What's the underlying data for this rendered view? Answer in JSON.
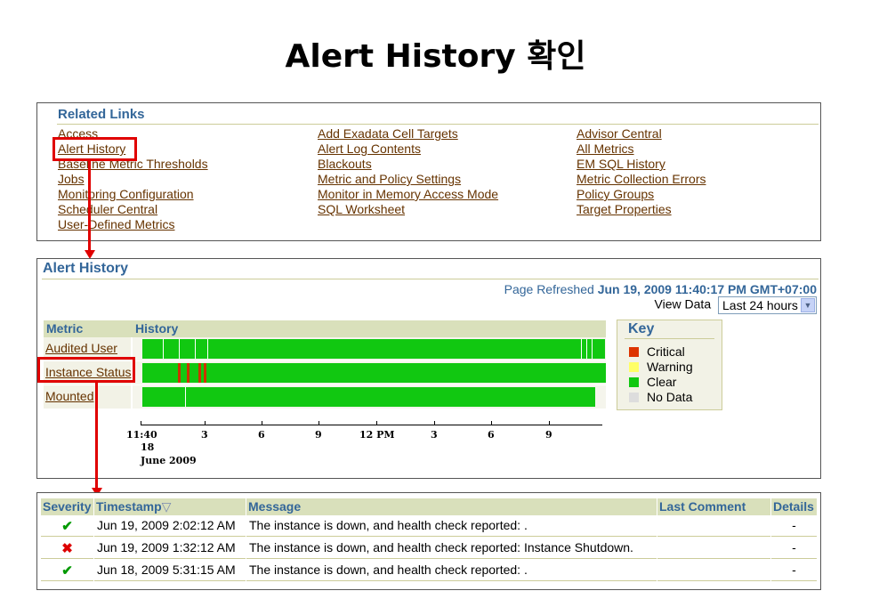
{
  "slide_title": "Alert History 확인",
  "related_links": {
    "title": "Related Links",
    "columns": [
      [
        "Access",
        "Alert History",
        "Baseline Metric Thresholds",
        "Jobs",
        "Monitoring Configuration",
        "Scheduler Central",
        "User-Defined Metrics"
      ],
      [
        "Add Exadata Cell Targets",
        "Alert Log Contents",
        "Blackouts",
        "Metric and Policy Settings",
        "Monitor in Memory Access Mode",
        "SQL Worksheet"
      ],
      [
        "Advisor Central",
        "All Metrics",
        "EM SQL History",
        "Metric Collection Errors",
        "Policy Groups",
        "Target Properties"
      ]
    ]
  },
  "alert_history": {
    "title": "Alert History",
    "page_refreshed_label": "Page Refreshed",
    "page_refreshed_value": "Jun 19, 2009 11:40:17 PM GMT+07:00",
    "view_data_label": "View Data",
    "view_data_selected": "Last 24 hours",
    "metric_header": "Metric",
    "history_header": "History",
    "metrics": [
      "Audited User",
      "Instance Status",
      "Mounted"
    ],
    "axis_labels": [
      "11:40",
      "3",
      "6",
      "9",
      "12 PM",
      "3",
      "6",
      "9"
    ],
    "axis_sub1": "18",
    "axis_sub2": "June 2009",
    "key": {
      "title": "Key",
      "items": [
        "Critical",
        "Warning",
        "Clear",
        "No Data"
      ],
      "colors": [
        "#dd3300",
        "#ffff66",
        "#11c811",
        "#dddddd"
      ]
    }
  },
  "alerts_table": {
    "headers": [
      "Severity",
      "Timestamp",
      "Message",
      "Last Comment",
      "Details"
    ],
    "sort_indicator": "▽",
    "rows": [
      {
        "severity": "✔",
        "timestamp": "Jun 19, 2009 2:02:12 AM",
        "message": "The instance is down, and health check reported: .",
        "comment": "",
        "details": "-"
      },
      {
        "severity": "✖",
        "timestamp": "Jun 19, 2009 1:32:12 AM",
        "message": "The instance is down, and health check reported: Instance Shutdown.",
        "comment": "",
        "details": "-"
      },
      {
        "severity": "✔",
        "timestamp": "Jun 18, 2009 5:31:15 AM",
        "message": "The instance is down, and health check reported: .",
        "comment": "",
        "details": "-"
      }
    ]
  }
}
